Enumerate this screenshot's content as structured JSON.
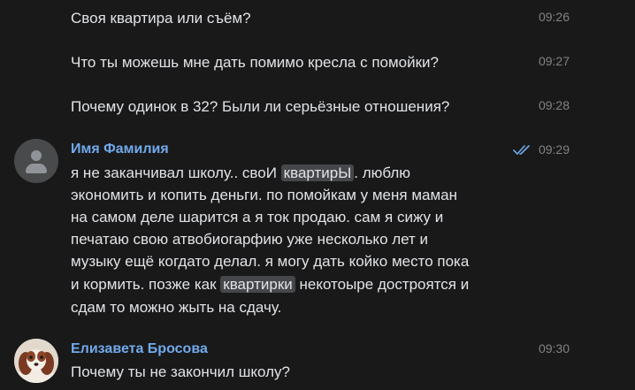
{
  "messages_top": [
    {
      "text": "Своя квартира или съём?",
      "time": "09:26"
    },
    {
      "text": "Что ты можешь мне дать помимо кресла с помойки?",
      "time": "09:27"
    },
    {
      "text": "Почему одинок в 32? Были ли серьёзные отношения?",
      "time": "09:28"
    }
  ],
  "message_1": {
    "sender": "Имя Фамилия",
    "time": "09:29",
    "read_icon": "double-check-icon",
    "line1_before": "я не заканчивал школу.. своИ ",
    "line1_highlight": "квартирЫ",
    "line1_after": ". люблю",
    "line2": "экономить и копить деньги. по помойкам у меня маман",
    "line3": "на самом деле шарится а я ток продаю. сам я сижу и",
    "line4": "печатаю свою атвобиогарфию уже несколько лет и",
    "line5": "музыку ещё когдато делал.  я могу дать койко место пока",
    "line6_before": "и кормить. позже как ",
    "line6_highlight": "квартирки",
    "line6_after": " некотоыре достроятся и",
    "line7": "сдам то можно жыть на сдачу."
  },
  "message_2": {
    "sender": "Елизавета Бросова",
    "time": "09:30",
    "text": "Почему ты не закончил школу?"
  },
  "colors": {
    "background": "#19191a",
    "text": "#e1e3e6",
    "sender": "#71aaeb",
    "time": "#828282",
    "highlight": "#45474b"
  }
}
